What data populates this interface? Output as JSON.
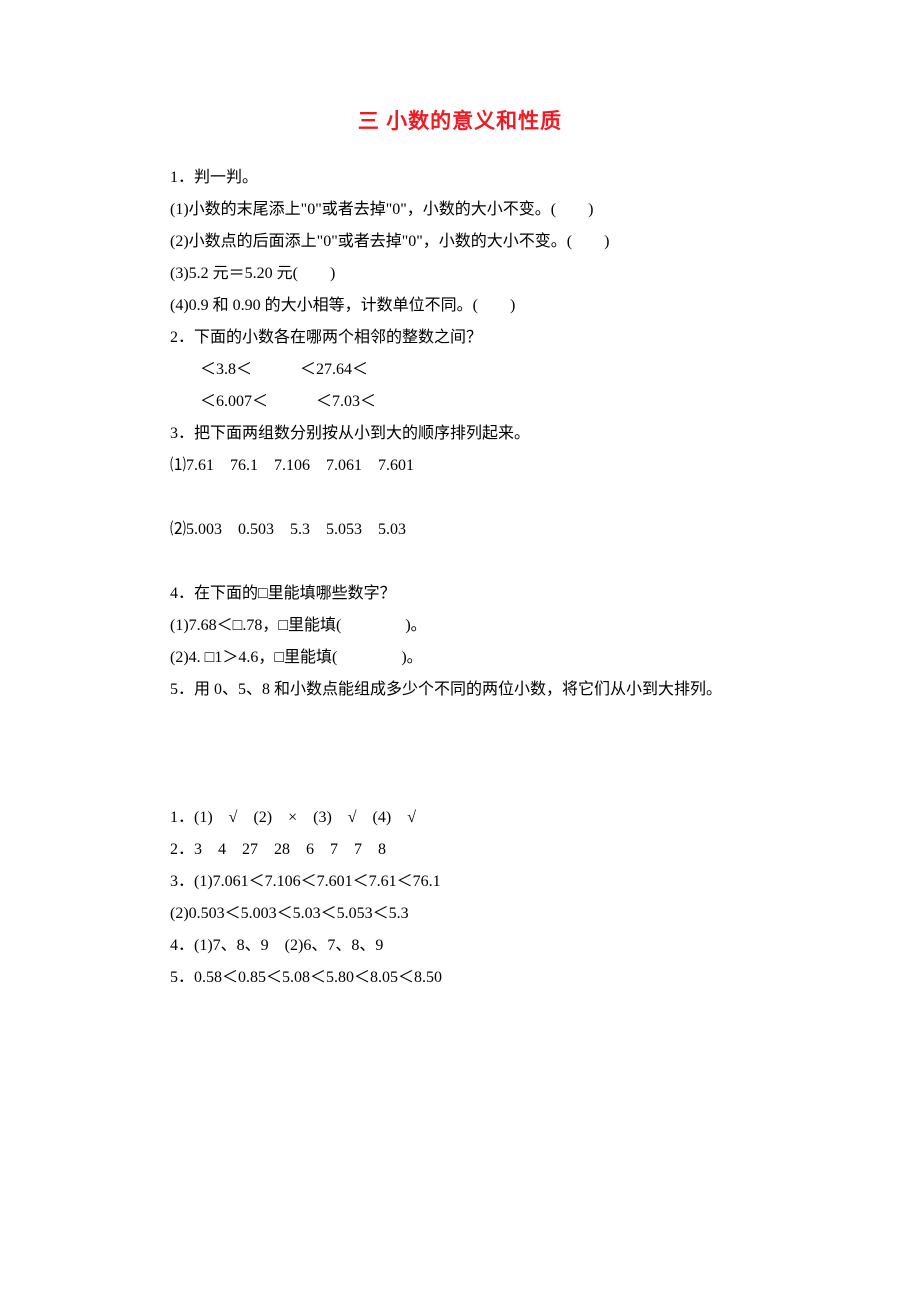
{
  "title": "三 小数的意义和性质",
  "q1": {
    "stem": "1．判一判。",
    "a": "(1)小数的末尾添上\"0\"或者去掉\"0\"，小数的大小不变。(　　)",
    "b": "(2)小数点的后面添上\"0\"或者去掉\"0\"，小数的大小不变。(　　)",
    "c": "(3)5.2 元＝5.20 元(　　)",
    "d": "(4)0.9 和 0.90 的大小相等，计数单位不同。(　　)"
  },
  "q2": {
    "stem": "2．下面的小数各在哪两个相邻的整数之间？",
    "line1": "　＜3.8＜　　　＜27.64＜",
    "line2": "　＜6.007＜　　　＜7.03＜"
  },
  "q3": {
    "stem": "3．把下面两组数分别按从小到大的顺序排列起来。",
    "a": "⑴7.61　76.1　7.106　7.061　7.601",
    "b": "⑵5.003　0.503　5.3　5.053　5.03"
  },
  "q4": {
    "stem": "4．在下面的□里能填哪些数字？",
    "a": "(1)7.68＜□.78，□里能填(　　　　)。",
    "b": "(2)4. □1＞4.6，□里能填(　　　　)。"
  },
  "q5": "5．用 0、5、8 和小数点能组成多少个不同的两位小数，将它们从小到大排列。",
  "ans": {
    "a1": "1．(1)　√　(2)　×　(3)　√　(4)　√",
    "a2": "2．3　4　27　28　6　7　7　8",
    "a3_1": "3．(1)7.061＜7.106＜7.601＜7.61＜76.1",
    "a3_2": "(2)0.503＜5.003＜5.03＜5.053＜5.3",
    "a4": "4．(1)7、8、9　(2)6、7、8、9",
    "a5": "5．0.58＜0.85＜5.08＜5.80＜8.05＜8.50"
  }
}
